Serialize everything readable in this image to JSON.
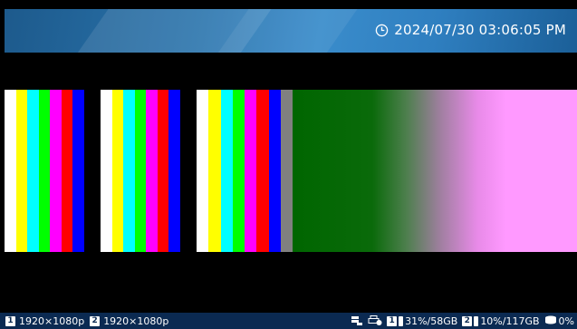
{
  "header": {
    "datetime": "2024/07/30 03:06:05 PM",
    "clock_icon": "clock-icon"
  },
  "video": {
    "bar_groups": [
      [
        "#ffffff",
        "#ffff00",
        "#00ffff",
        "#00ff00",
        "#ff00ff",
        "#ff0000",
        "#0000ff",
        "#000000"
      ],
      [
        "#ffffff",
        "#ffff00",
        "#00ffff",
        "#00ff00",
        "#ff00ff",
        "#ff0000",
        "#0000ff",
        "#000000"
      ],
      [
        "#ffffff",
        "#ffff00",
        "#00ffff",
        "#00ff00",
        "#ff00ff",
        "#ff0000",
        "#0000ff",
        "#808080"
      ]
    ]
  },
  "status": {
    "inputs": [
      {
        "index": "1",
        "resolution": "1920×1080p"
      },
      {
        "index": "2",
        "resolution": "1920×1080p"
      }
    ],
    "icons": [
      "recording-icon",
      "printer-icon"
    ],
    "disks": [
      {
        "index": "1",
        "usage": "31%/58GB"
      },
      {
        "index": "2",
        "usage": "10%/117GB"
      }
    ],
    "storage_usage": "0%"
  }
}
